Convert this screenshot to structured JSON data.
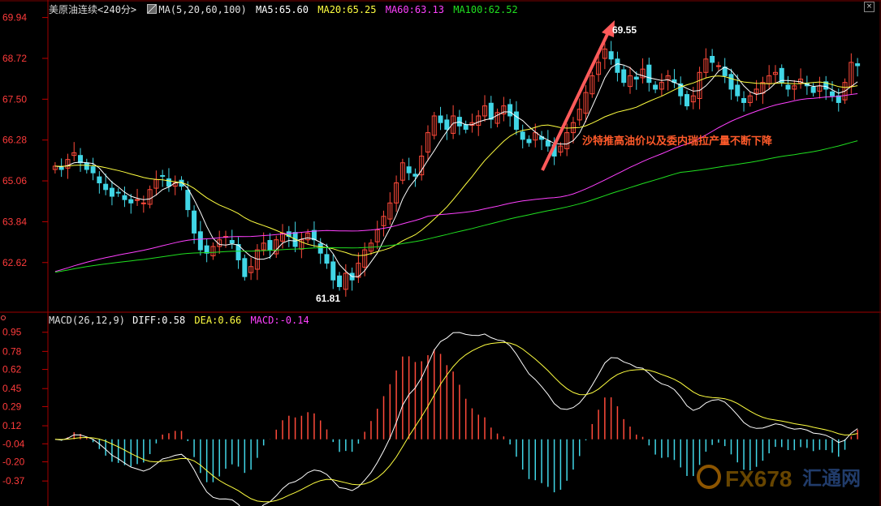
{
  "header": {
    "instrument": "美原油连续",
    "period": "<240分>",
    "ma_label": "MA(5,20,60,100)",
    "ma5": "MA5:65.60",
    "ma20": "MA20:65.25",
    "ma60": "MA60:63.13",
    "ma100": "MA100:62.52"
  },
  "macd_header": {
    "label": "MACD(26,12,9)",
    "diff": "DIFF:0.58",
    "dea": "DEA:0.66",
    "macd": "MACD:-0.14"
  },
  "colors": {
    "up": "#ff4a3a",
    "down": "#41d6e6",
    "ma5": "#ffffff",
    "ma20": "#ffff40",
    "ma60": "#ff40ff",
    "ma100": "#20e020",
    "axis": "#c00000",
    "tick": "#ff3b3b"
  },
  "chart_data": [
    {
      "type": "candlestick",
      "title": "美原油连续<240分>",
      "ylim": [
        61.5,
        70.1
      ],
      "y_ticks": [
        "69.94",
        "68.72",
        "67.50",
        "66.28",
        "65.06",
        "63.84",
        "62.62"
      ],
      "annotations": {
        "high_label": "69.55",
        "low_label": "61.81",
        "note": "沙特推高油价以及委内瑞拉产量不断下降"
      },
      "closes": [
        65.5,
        65.4,
        65.7,
        65.9,
        65.6,
        65.4,
        65.3,
        65.0,
        64.8,
        64.6,
        64.7,
        64.5,
        64.4,
        64.5,
        64.4,
        64.8,
        65.1,
        65.2,
        64.9,
        65.0,
        64.9,
        64.2,
        63.5,
        63.0,
        62.9,
        63.1,
        63.3,
        63.4,
        63.2,
        62.7,
        62.2,
        62.5,
        63.0,
        63.2,
        63.0,
        63.3,
        63.5,
        63.4,
        63.1,
        63.3,
        63.5,
        63.3,
        62.9,
        62.6,
        62.1,
        61.9,
        62.3,
        62.1,
        62.6,
        63.0,
        63.2,
        63.6,
        64.0,
        64.4,
        65.0,
        65.6,
        65.3,
        65.2,
        65.8,
        66.5,
        67.0,
        66.8,
        66.6,
        67.0,
        66.7,
        66.6,
        66.8,
        67.0,
        67.3,
        66.9,
        67.1,
        67.3,
        67.0,
        66.6,
        66.3,
        66.2,
        66.5,
        66.3,
        66.1,
        65.8,
        66.1,
        66.5,
        66.8,
        67.2,
        67.7,
        68.2,
        68.6,
        69.0,
        68.7,
        68.3,
        68.0,
        68.2,
        68.1,
        68.4,
        68.0,
        67.8,
        68.0,
        68.2,
        68.0,
        67.6,
        67.3,
        67.6,
        68.3,
        68.7,
        68.6,
        68.5,
        68.2,
        67.8,
        67.6,
        67.4,
        67.6,
        67.8,
        68.0,
        68.2,
        68.3,
        68.0,
        67.8,
        67.9,
        68.1,
        67.9,
        67.7,
        67.9,
        67.8,
        67.6,
        67.4,
        68.0,
        68.6,
        68.5
      ],
      "ma5_last": 65.6,
      "ma20_last": 65.25,
      "ma60_last": 63.13,
      "ma100_last": 62.52
    },
    {
      "type": "bar+line",
      "title": "MACD(26,12,9)",
      "ylim": [
        -0.52,
        1.02
      ],
      "y_ticks": [
        "0.95",
        "0.78",
        "0.62",
        "0.45",
        "0.29",
        "0.12",
        "-0.04",
        "-0.20",
        "-0.37"
      ],
      "diff_last": 0.58,
      "dea_last": 0.66,
      "macd_last": -0.14
    }
  ],
  "watermark": {
    "brand": "FX678",
    "cn": "汇通网"
  }
}
